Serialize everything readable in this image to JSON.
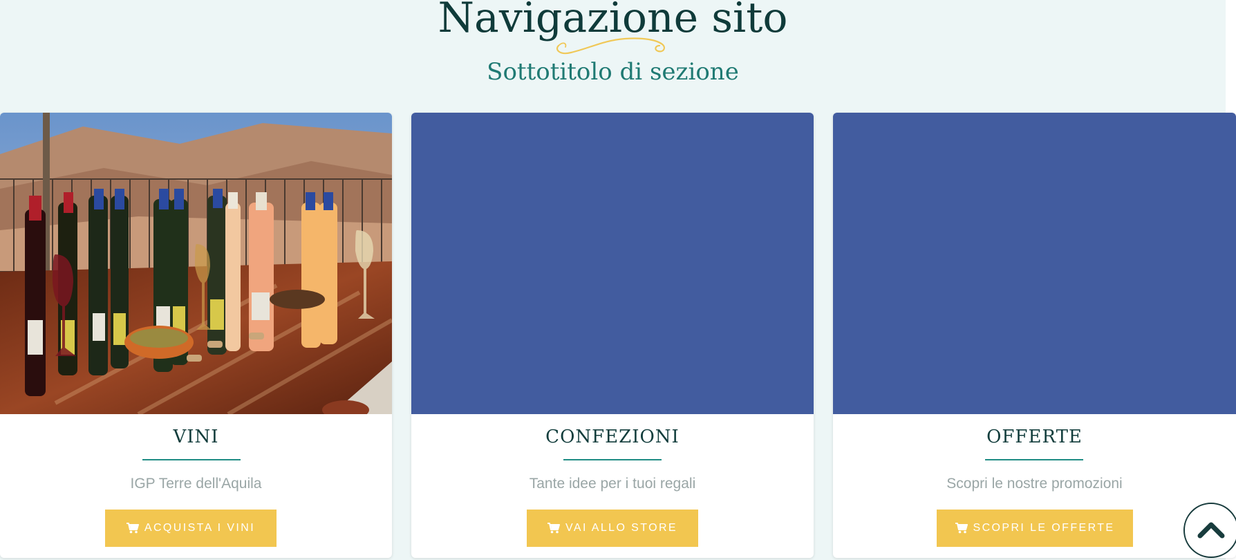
{
  "header": {
    "title": "Navigazione sito",
    "subtitle": "Sottotitolo di sezione"
  },
  "colors": {
    "section_bg": "#edf6f6",
    "title": "#0f3b3a",
    "subtitle": "#1f7a73",
    "accent_rule": "#1f8c84",
    "button_bg": "#f2c650",
    "placeholder_blue": "#425c9f",
    "flourish": "#f0c857"
  },
  "cards": [
    {
      "media": "wine-bottles-table-photo",
      "title": "VINI",
      "description": "IGP Terre dell'Aquila",
      "button_label": "ACQUISTA I VINI",
      "button_icon": "cart-icon"
    },
    {
      "media": "blue-placeholder",
      "title": "CONFEZIONI",
      "description": "Tante idee per i tuoi regali",
      "button_label": "VAI ALLO STORE",
      "button_icon": "cart-icon"
    },
    {
      "media": "blue-placeholder",
      "title": "OFFERTE",
      "description": "Scopri le nostre promozioni",
      "button_label": "SCOPRI LE OFFERTE",
      "button_icon": "cart-icon"
    }
  ],
  "scroll_top": {
    "icon": "chevron-up-icon"
  }
}
